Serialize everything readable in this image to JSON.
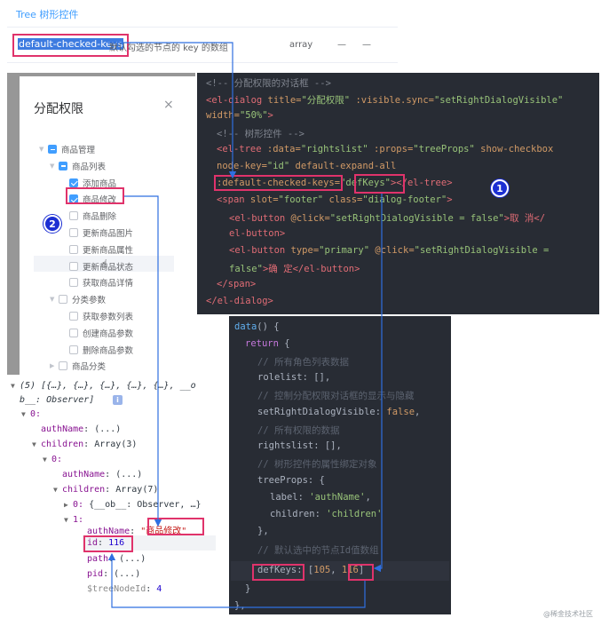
{
  "docs": {
    "section_title": "Tree 树形控件",
    "attr_name": "default-checked-keys",
    "attr_desc": "默认勾选的节点的 key 的数组",
    "attr_type": "array",
    "attr_optional": "—",
    "attr_default": "—"
  },
  "dialog": {
    "title": "分配权限",
    "close_glyph": "×",
    "tree": [
      {
        "label": "商品管理",
        "level": 0,
        "state": "half",
        "expanded": true
      },
      {
        "label": "商品列表",
        "level": 1,
        "state": "half",
        "expanded": true
      },
      {
        "label": "添加商品",
        "level": 2,
        "state": "on"
      },
      {
        "label": "商品修改",
        "level": 2,
        "state": "on"
      },
      {
        "label": "商品删除",
        "level": 2,
        "state": "off"
      },
      {
        "label": "更新商品图片",
        "level": 2,
        "state": "off"
      },
      {
        "label": "更新商品属性",
        "level": 2,
        "state": "off"
      },
      {
        "label": "更新商品状态",
        "level": 2,
        "state": "off"
      },
      {
        "label": "获取商品详情",
        "level": 2,
        "state": "off"
      },
      {
        "label": "分类参数",
        "level": 1,
        "state": "off",
        "expanded": true
      },
      {
        "label": "获取参数列表",
        "level": 2,
        "state": "off"
      },
      {
        "label": "创建商品参数",
        "level": 2,
        "state": "off"
      },
      {
        "label": "删除商品参数",
        "level": 2,
        "state": "off"
      },
      {
        "label": "商品分类",
        "level": 1,
        "state": "off",
        "expanded": false
      }
    ]
  },
  "badges": {
    "one": "1",
    "two": "2"
  },
  "code_template": {
    "l1_comment": "<!-- 分配权限的对话框 -->",
    "l2_open": "<el-dialog",
    "l2_title_attr": " title=",
    "l2_title_val": "\"分配权限\"",
    "l2_visible_attr": " :visible.sync=",
    "l2_visible_val": "\"setRightDialogVisible\"",
    "l3_width_attr": "width=",
    "l3_width_val": "\"50%\"",
    "l3_close": ">",
    "l4_comment": "<!-- 树形控件 -->",
    "l5_open": "<el-tree",
    "l5_data_attr": " :data=",
    "l5_data_val": "\"rightslist\"",
    "l5_props_attr": " :props=",
    "l5_props_val": "\"treeProps\"",
    "l5_check_attr": " show-checkbox",
    "l6_nodekey_attr": "node-key=",
    "l6_nodekey_val": "\"id\"",
    "l6_expand_attr": " default-expand-all",
    "l7_checked_attr": ":default-checked-keys=",
    "l7_checked_val": "\"defKeys\"",
    "l7_close": "></el-tree>",
    "l8_open": "<span",
    "l8_slot_attr": " slot=",
    "l8_slot_val": "\"footer\"",
    "l8_class_attr": " class=",
    "l8_class_val": "\"dialog-footer\"",
    "l8_close": ">",
    "l9_open": "<el-button",
    "l9_click_attr": " @click=",
    "l9_click_val": "\"setRightDialogVisible = false\"",
    "l9_text": ">取 消</",
    "l10_text": "el-button",
    "l10_close": ">",
    "l11_open": "<el-button",
    "l11_type_attr": " type=",
    "l11_type_val": "\"primary\"",
    "l11_click_attr": " @click=",
    "l11_click_val": "\"setRightDialogVisible =",
    "l12_val": "false\"",
    "l12_text": ">确 定</el-button>",
    "l13_close": "</span>",
    "l14_close": "</el-dialog>"
  },
  "code_script": {
    "l1_fn": "data",
    "l1_rest": "() {",
    "l2_kw": "return",
    "l2_rest": " {",
    "l3_comment": "// 所有角色列表数据",
    "l4_key": "rolelist",
    "l4_rest": ": [],",
    "l5_comment": "// 控制分配权限对话框的显示与隐藏",
    "l6_key": "setRightDialogVisible",
    "l6_sep": ": ",
    "l6_val": "false",
    "l6_end": ",",
    "l7_comment": "// 所有权限的数据",
    "l8_key": "rightslist",
    "l8_rest": ": [],",
    "l9_comment": "// 树形控件的属性绑定对象",
    "l10_key": "treeProps",
    "l10_rest": ": {",
    "l11_key": "label",
    "l11_sep": ": ",
    "l11_val": "'authName'",
    "l11_end": ",",
    "l12_key": "children",
    "l12_sep": ": ",
    "l12_val": "'children'",
    "l13_close": "},",
    "l14_comment": "// 默认选中的节点Id值数组",
    "l15_key": "defKeys",
    "l15_sep": ": ",
    "l15_open": "[",
    "l15_v1": "105",
    "l15_comma": ", ",
    "l15_v2": "116",
    "l15_close": "]",
    "l16_close": "}",
    "l17_close": "},"
  },
  "console": {
    "header1": "(5) [{…}, {…}, {…}, {…}, {…}, __o",
    "header2": "b__: Observer]",
    "info_glyph": "i",
    "i0": "0:",
    "authName_key": "authName",
    "ellipsis_val": "(...)",
    "children_key": "children",
    "array3": "Array(3)",
    "array7": "Array(7)",
    "i0b": "0:",
    "i0c": "0:",
    "obj_preview": "{__ob__: Observer, …}",
    "i1": "1:",
    "authName_val": "\"商品修改\"",
    "id_key": "id",
    "id_val": "116",
    "path_key": "path",
    "pid_key": "pid",
    "treenode_key": "$treeNodeId",
    "treenode_val": "4",
    "colon": ": "
  },
  "watermark": "@稀金技术社区",
  "colors": {
    "accent": "#409eff",
    "highlight_box": "#e0336b",
    "arrow": "#2f6fe0",
    "badge": "#1c2fd3"
  }
}
